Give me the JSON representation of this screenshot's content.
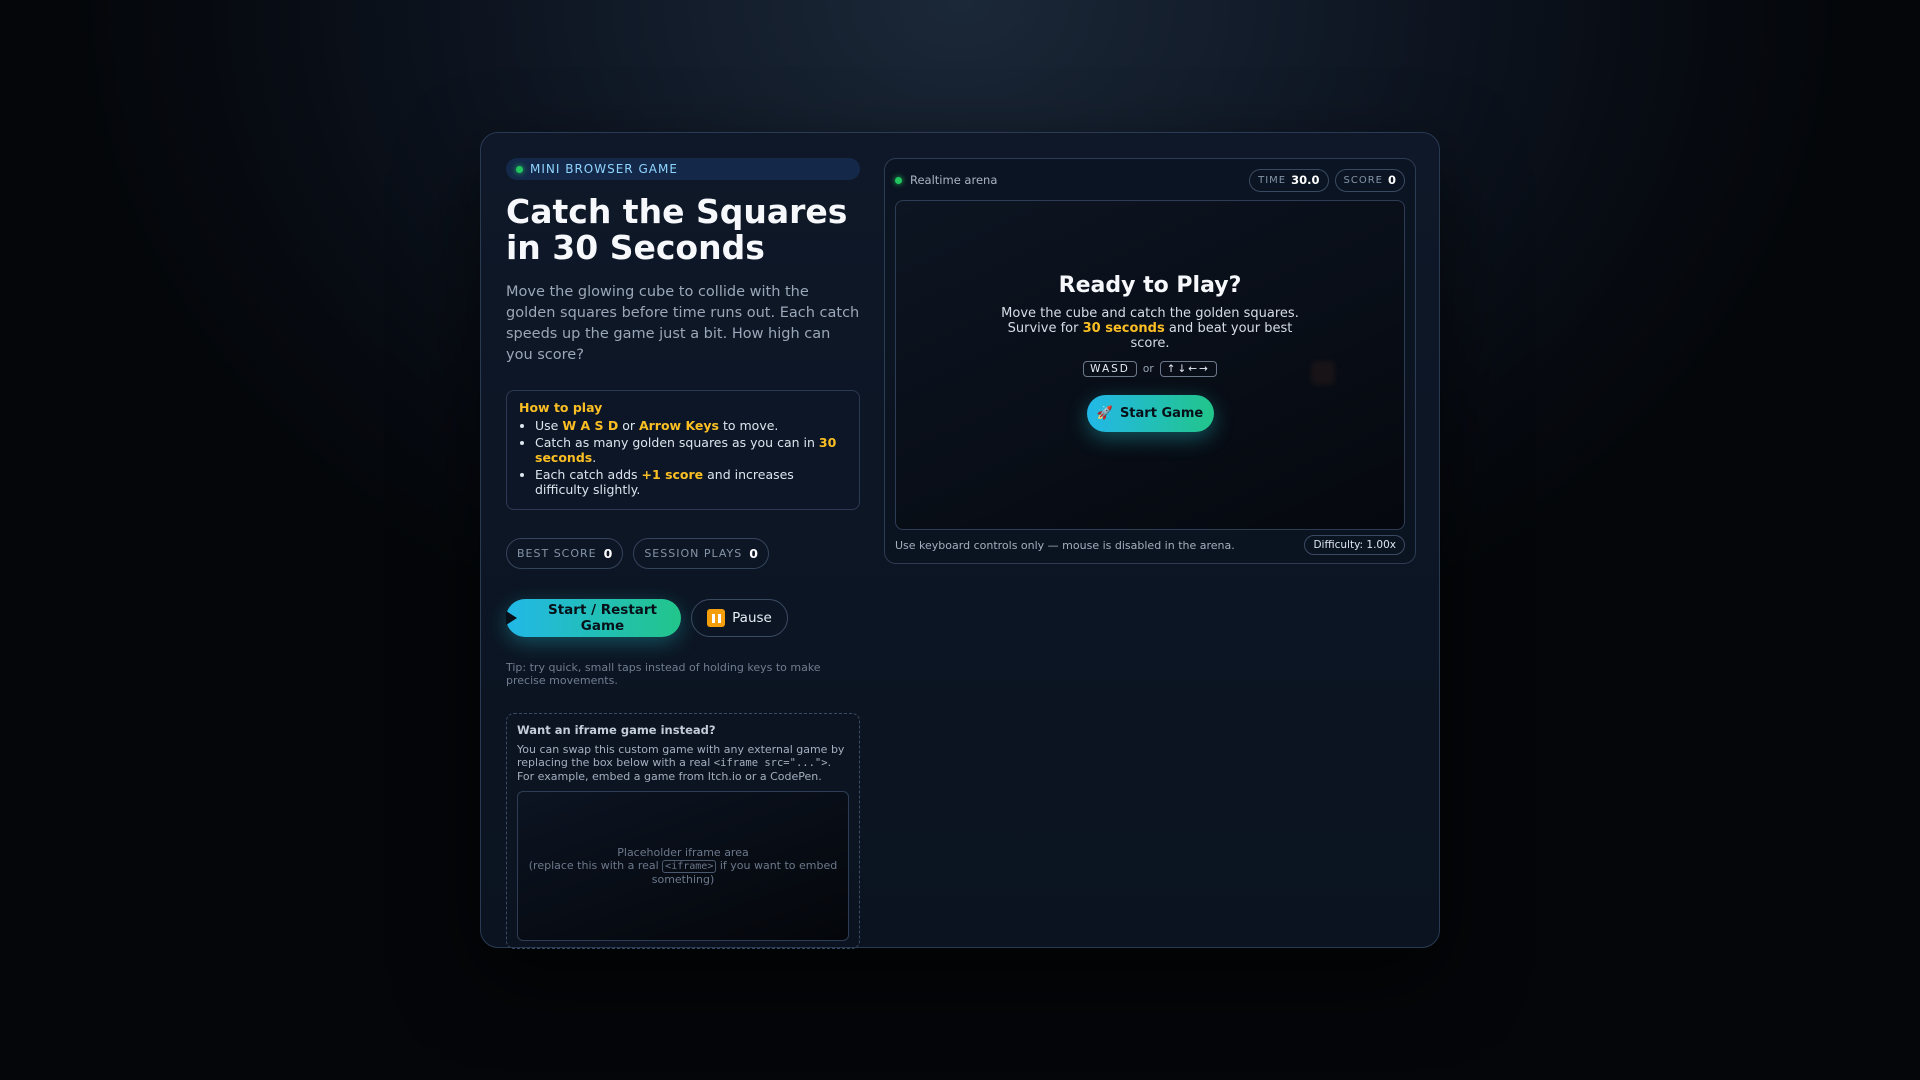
{
  "left": {
    "tag": "MINI BROWSER GAME",
    "title": "Catch the Squares in 30 Seconds",
    "description": "Move the glowing cube to collide with the golden squares before time runs out. Each catch speeds up the game just a bit. How high can you score?",
    "howto": {
      "heading": "How to play",
      "item1": {
        "a": "Use ",
        "b": "W A S D",
        "c": " or ",
        "d": "Arrow Keys",
        "e": " to move."
      },
      "item2": {
        "a": "Catch as many golden squares as you can in ",
        "b": "30 seconds",
        "c": "."
      },
      "item3": {
        "a": "Each catch adds ",
        "b": "+1 score",
        "c": " and increases difficulty slightly."
      }
    },
    "stats": {
      "best_label": "BEST SCORE",
      "best_value": "0",
      "plays_label": "SESSION PLAYS",
      "plays_value": "0"
    },
    "buttons": {
      "start_label": "Start / Restart Game",
      "pause_label": "Pause"
    },
    "tip": "Tip: try quick, small taps instead of holding keys to make precise movements.",
    "iframe": {
      "heading": "Want an iframe game instead?",
      "text_a": "You can swap this custom game with any external game by replacing the box below with a real ",
      "text_code": "<iframe src=\"...\">",
      "text_b": ". For example, embed a game from Itch.io or a CodePen.",
      "ph_line1": "Placeholder iframe area",
      "ph_a": "(replace this with a real ",
      "ph_code": "<iframe>",
      "ph_b": " if you want to embed something)"
    }
  },
  "arena": {
    "label": "Realtime arena",
    "time_label": "TIME",
    "time_value": "30.0",
    "score_label": "SCORE",
    "score_value": "0",
    "ready_title": "Ready to Play?",
    "ready_line1": "Move the cube and catch the golden squares.",
    "ready_line2_a": "Survive for ",
    "ready_line2_b": "30 seconds",
    "ready_line2_c": " and beat your best score.",
    "keys_wasd": "WASD",
    "keys_or": "or",
    "keys_arrows": "↑↓←→",
    "start_label": "Start Game",
    "footer": "Use keyboard controls only — mouse is disabled in the arena.",
    "difficulty": "Difficulty: 1.00x"
  },
  "colors": {
    "accent_start": "#22b8e8",
    "accent_end": "#22c58a",
    "highlight": "#fbbf24",
    "status": "#22c55e",
    "pause": "#f59e0b"
  },
  "icons": {
    "tag": "status-dot",
    "start": "play-icon",
    "pause": "pause-icon",
    "rocket": "rocket-icon"
  }
}
